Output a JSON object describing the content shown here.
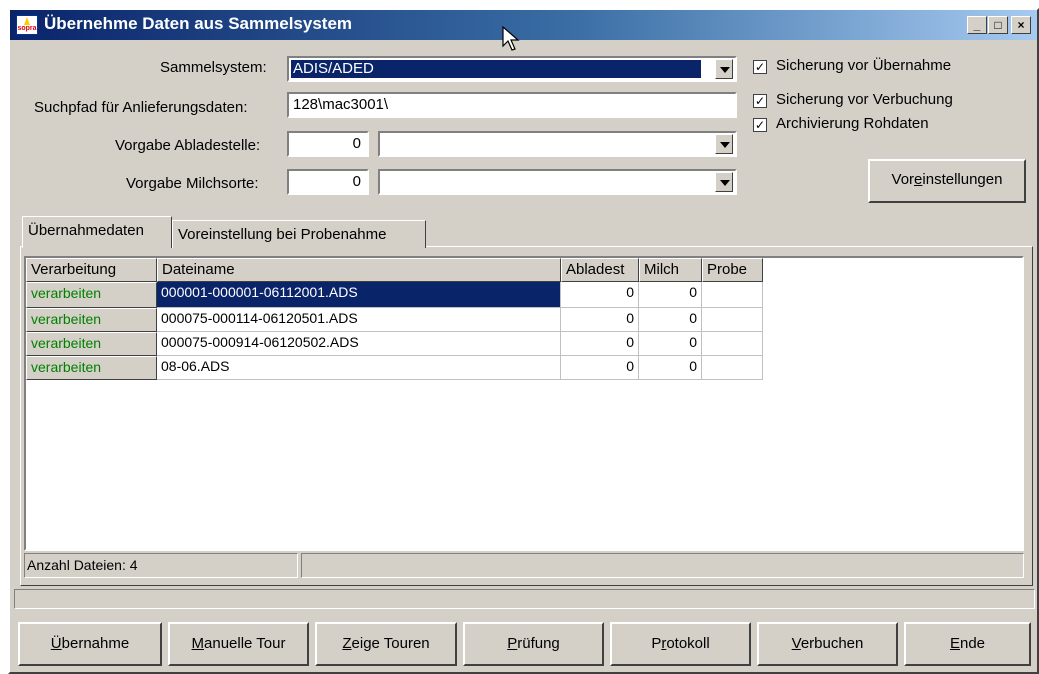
{
  "window": {
    "title": "Übernehme Daten aus Sammelsystem",
    "controls": {
      "minimize": "_",
      "maximize": "□",
      "close": "×"
    }
  },
  "form": {
    "sammelsystem_label": "Sammelsystem:",
    "sammelsystem_value": "ADIS/ADED",
    "suchpfad_label": "Suchpfad für Anlieferungsdaten:",
    "suchpfad_value": "128\\mac3001\\",
    "abladestelle_label": "Vorgabe Abladestelle:",
    "abladestelle_num": "0",
    "abladestelle_select": "",
    "milchsorte_label": "Vorgabe Milchsorte:",
    "milchsorte_num": "0",
    "milchsorte_select": ""
  },
  "options": {
    "sicherung_uebernahme": {
      "label": "Sicherung vor Übernahme",
      "checked": true
    },
    "sicherung_verbuchung": {
      "label": "Sicherung vor  Verbuchung",
      "checked": true
    },
    "archivierung": {
      "label": "Archivierung Rohdaten",
      "checked": true
    },
    "voreinstellungen_pre": "Vor",
    "voreinstellungen_u": "e",
    "voreinstellungen_post": "instellungen"
  },
  "tabs": [
    {
      "label": "Übernahmedaten",
      "active": true
    },
    {
      "label": "Voreinstellung bei Probenahme",
      "active": false
    }
  ],
  "table": {
    "columns": [
      "Verarbeitung",
      "Dateiname",
      "Abladest",
      "Milch",
      "Probe"
    ],
    "rows": [
      {
        "verarbeitung": "verarbeiten",
        "dateiname": "000001-000001-06112001.ADS",
        "abladest": "0",
        "milch": "0",
        "probe": "",
        "selected": true
      },
      {
        "verarbeitung": "verarbeiten",
        "dateiname": "000075-000114-06120501.ADS",
        "abladest": "0",
        "milch": "0",
        "probe": ""
      },
      {
        "verarbeitung": "verarbeiten",
        "dateiname": "000075-000914-06120502.ADS",
        "abladest": "0",
        "milch": "0",
        "probe": ""
      },
      {
        "verarbeitung": "verarbeiten",
        "dateiname": "08-06.ADS",
        "abladest": "0",
        "milch": "0",
        "probe": ""
      }
    ]
  },
  "status": {
    "anzahl": "Anzahl Dateien: 4"
  },
  "buttons": [
    {
      "u": "Ü",
      "rest": "bernahme"
    },
    {
      "u": "M",
      "rest": "anuelle Tour"
    },
    {
      "u": "Z",
      "rest": "eige Touren"
    },
    {
      "u": "P",
      "rest": "rüfung"
    },
    {
      "pre": "P",
      "u": "r",
      "rest": "otokoll"
    },
    {
      "u": "V",
      "rest": "erbuchen"
    },
    {
      "u": "E",
      "rest": "nde"
    }
  ],
  "colors": {
    "titlebar": "#0a246a",
    "selection": "#0a246a",
    "process_text": "#008000",
    "face": "#d4d0c8"
  }
}
